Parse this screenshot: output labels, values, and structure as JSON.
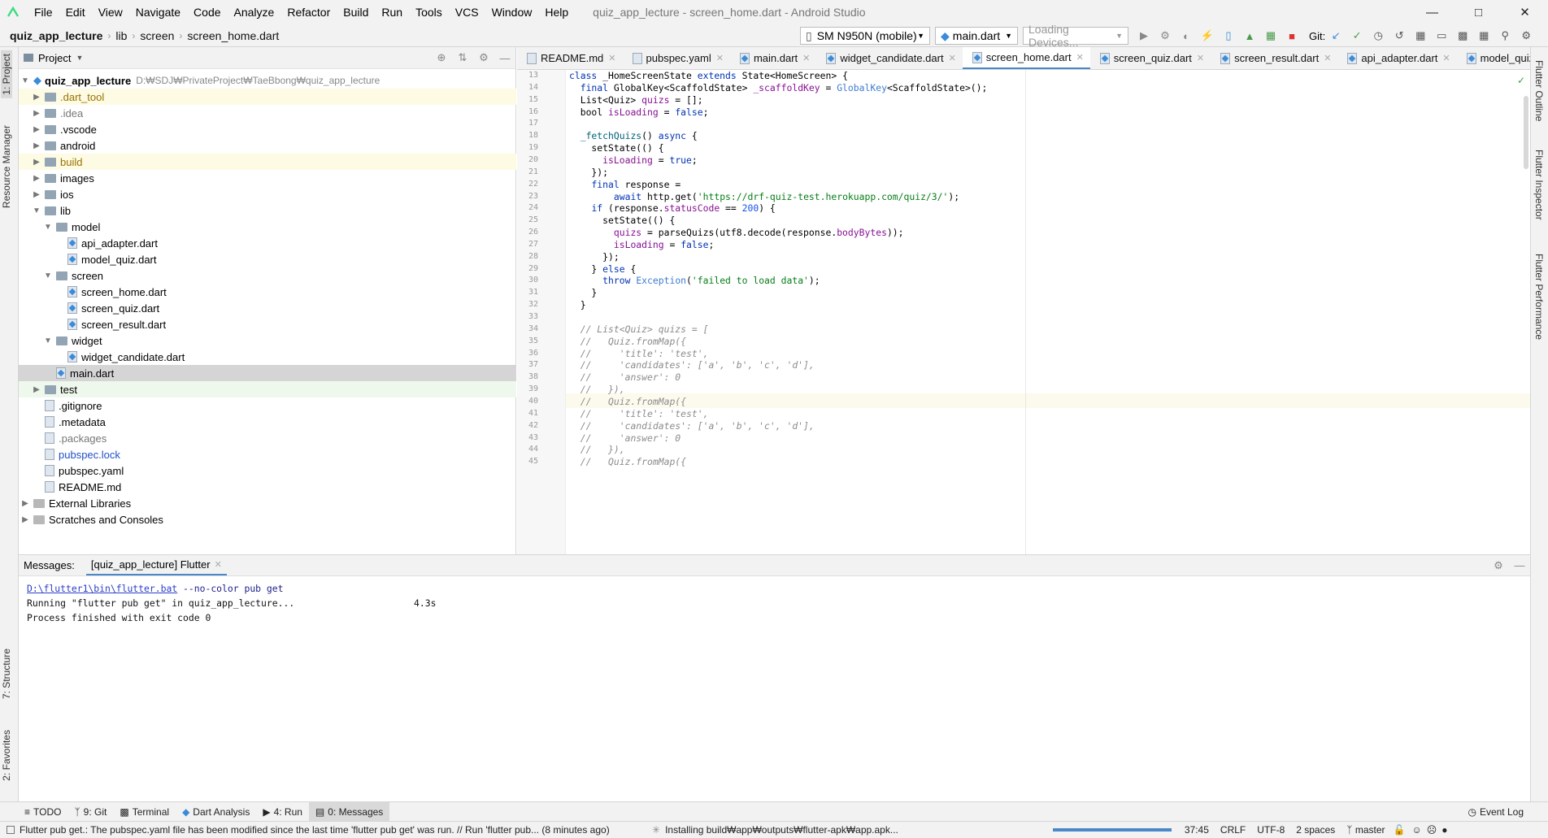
{
  "titlebar": {
    "menu": [
      "File",
      "Edit",
      "View",
      "Navigate",
      "Code",
      "Analyze",
      "Refactor",
      "Build",
      "Run",
      "Tools",
      "VCS",
      "Window",
      "Help"
    ],
    "window_title": "quiz_app_lecture - screen_home.dart - Android Studio"
  },
  "navbar": {
    "breadcrumbs": [
      "quiz_app_lecture",
      "lib",
      "screen",
      "screen_home.dart"
    ],
    "device": "SM N950N (mobile)",
    "run_config": "main.dart",
    "loading_devices": "Loading Devices...",
    "git_label": "Git:"
  },
  "sidebar_left": {
    "tabs": [
      "1: Project",
      "Resource Manager",
      "7: Structure",
      "2: Favorites"
    ]
  },
  "sidebar_right": {
    "tabs": [
      "Flutter Outline",
      "Flutter Inspector",
      "Flutter Performance"
    ]
  },
  "project": {
    "header": "Project",
    "root_name": "quiz_app_lecture",
    "root_path": "D:₩SDJ₩PrivateProject₩TaeBbong₩quiz_app_lecture",
    "items": [
      {
        "label": ".dart_tool",
        "kind": "folder",
        "depth": 1,
        "arrow": "▶",
        "color": "#9a7200",
        "hl": true
      },
      {
        "label": ".idea",
        "kind": "folder",
        "depth": 1,
        "arrow": "▶",
        "color": "#777777",
        "hl": false
      },
      {
        "label": ".vscode",
        "kind": "folder",
        "depth": 1,
        "arrow": "▶",
        "color": "#000000",
        "hl": false
      },
      {
        "label": "android",
        "kind": "folder",
        "depth": 1,
        "arrow": "▶",
        "color": "#000000",
        "hl": false
      },
      {
        "label": "build",
        "kind": "folder",
        "depth": 1,
        "arrow": "▶",
        "color": "#9a7200",
        "hl": true
      },
      {
        "label": "images",
        "kind": "folder",
        "depth": 1,
        "arrow": "▶",
        "color": "#000000",
        "hl": false
      },
      {
        "label": "ios",
        "kind": "folder",
        "depth": 1,
        "arrow": "▶",
        "color": "#000000",
        "hl": false
      },
      {
        "label": "lib",
        "kind": "folder",
        "depth": 1,
        "arrow": "▼",
        "color": "#000000",
        "hl": false
      },
      {
        "label": "model",
        "kind": "folder",
        "depth": 2,
        "arrow": "▼",
        "color": "#000000",
        "hl": false
      },
      {
        "label": "api_adapter.dart",
        "kind": "dart",
        "depth": 3,
        "arrow": "",
        "color": "#000000",
        "hl": false
      },
      {
        "label": "model_quiz.dart",
        "kind": "dart",
        "depth": 3,
        "arrow": "",
        "color": "#000000",
        "hl": false
      },
      {
        "label": "screen",
        "kind": "folder",
        "depth": 2,
        "arrow": "▼",
        "color": "#000000",
        "hl": false
      },
      {
        "label": "screen_home.dart",
        "kind": "dart",
        "depth": 3,
        "arrow": "",
        "color": "#000000",
        "hl": false
      },
      {
        "label": "screen_quiz.dart",
        "kind": "dart",
        "depth": 3,
        "arrow": "",
        "color": "#000000",
        "hl": false
      },
      {
        "label": "screen_result.dart",
        "kind": "dart",
        "depth": 3,
        "arrow": "",
        "color": "#000000",
        "hl": false
      },
      {
        "label": "widget",
        "kind": "folder",
        "depth": 2,
        "arrow": "▼",
        "color": "#000000",
        "hl": false
      },
      {
        "label": "widget_candidate.dart",
        "kind": "dart",
        "depth": 3,
        "arrow": "",
        "color": "#000000",
        "hl": false
      },
      {
        "label": "main.dart",
        "kind": "dart",
        "depth": 2,
        "arrow": "",
        "color": "#000000",
        "hl": false,
        "selected": true
      },
      {
        "label": "test",
        "kind": "folder",
        "depth": 1,
        "arrow": "▶",
        "color": "#000000",
        "hl": false,
        "green": true
      },
      {
        "label": ".gitignore",
        "kind": "file",
        "depth": 1,
        "arrow": "",
        "color": "#000000",
        "hl": false
      },
      {
        "label": ".metadata",
        "kind": "file",
        "depth": 1,
        "arrow": "",
        "color": "#000000",
        "hl": false
      },
      {
        "label": ".packages",
        "kind": "file",
        "depth": 1,
        "arrow": "",
        "color": "#777777",
        "hl": false
      },
      {
        "label": "pubspec.lock",
        "kind": "file",
        "depth": 1,
        "arrow": "",
        "color": "#1f4fc7",
        "hl": false
      },
      {
        "label": "pubspec.yaml",
        "kind": "file",
        "depth": 1,
        "arrow": "",
        "color": "#000000",
        "hl": false
      },
      {
        "label": "README.md",
        "kind": "file",
        "depth": 1,
        "arrow": "",
        "color": "#000000",
        "hl": false
      },
      {
        "label": "External Libraries",
        "kind": "lib",
        "depth": 0,
        "arrow": "▶",
        "color": "#000000",
        "hl": false
      },
      {
        "label": "Scratches and Consoles",
        "kind": "lib",
        "depth": 0,
        "arrow": "▶",
        "color": "#000000",
        "hl": false
      }
    ]
  },
  "editor": {
    "tabs": [
      "README.md",
      "pubspec.yaml",
      "main.dart",
      "widget_candidate.dart",
      "screen_home.dart",
      "screen_quiz.dart",
      "screen_result.dart",
      "api_adapter.dart",
      "model_quiz.dart"
    ],
    "active_tab": 4,
    "line_numbers": [
      "13",
      "14",
      "15",
      "16",
      "17",
      "18",
      "19",
      "20",
      "21",
      "22",
      "23",
      "24",
      "25",
      "26",
      "27",
      "28",
      "29",
      "30",
      "31",
      "32",
      "33",
      "34",
      "35",
      "36",
      "37",
      "38",
      "39",
      "40",
      "41",
      "42",
      "43",
      "44",
      "45"
    ],
    "lines": [
      [
        [
          "kw",
          "class "
        ],
        [
          "",
          "_HomeScreenState "
        ],
        [
          "kw",
          "extends "
        ],
        [
          "",
          "State<HomeScreen> {"
        ]
      ],
      [
        [
          "",
          "  "
        ],
        [
          "kw",
          "final "
        ],
        [
          "",
          "GlobalKey<ScaffoldState> "
        ],
        [
          "fld",
          "_scaffoldKey"
        ],
        [
          "",
          " = "
        ],
        [
          "typ",
          "GlobalKey"
        ],
        [
          "",
          "<ScaffoldState>();"
        ]
      ],
      [
        [
          "",
          "  List<Quiz> "
        ],
        [
          "fld",
          "quizs"
        ],
        [
          "",
          " = [];"
        ]
      ],
      [
        [
          "",
          "  bool "
        ],
        [
          "fld",
          "isLoading"
        ],
        [
          "",
          " = "
        ],
        [
          "kw",
          "false"
        ],
        [
          "",
          ";"
        ]
      ],
      [
        [
          "",
          ""
        ]
      ],
      [
        [
          "",
          "  "
        ],
        [
          "fn",
          "_fetchQuizs"
        ],
        [
          "",
          "() "
        ],
        [
          "kw",
          "async"
        ],
        [
          "",
          " {"
        ]
      ],
      [
        [
          "",
          "    setState(() {"
        ]
      ],
      [
        [
          "",
          "      "
        ],
        [
          "fld",
          "isLoading"
        ],
        [
          "",
          " = "
        ],
        [
          "kw",
          "true"
        ],
        [
          "",
          ";"
        ]
      ],
      [
        [
          "",
          "    });"
        ]
      ],
      [
        [
          "",
          "    "
        ],
        [
          "kw",
          "final "
        ],
        [
          "",
          "response ="
        ]
      ],
      [
        [
          "",
          "        "
        ],
        [
          "kw",
          "await "
        ],
        [
          "",
          "http.get("
        ],
        [
          "str",
          "'https://drf-quiz-test.herokuapp.com/quiz/3/'"
        ],
        [
          "",
          ");"
        ]
      ],
      [
        [
          "",
          "    "
        ],
        [
          "kw",
          "if "
        ],
        [
          "",
          "(response."
        ],
        [
          "fld",
          "statusCode"
        ],
        [
          "",
          " == "
        ],
        [
          "num",
          "200"
        ],
        [
          "",
          ") {"
        ]
      ],
      [
        [
          "",
          "      setState(() {"
        ]
      ],
      [
        [
          "",
          "        "
        ],
        [
          "fld",
          "quizs"
        ],
        [
          "",
          " = parseQuizs(utf8.decode(response."
        ],
        [
          "fld",
          "bodyBytes"
        ],
        [
          "",
          "));"
        ]
      ],
      [
        [
          "",
          "        "
        ],
        [
          "fld",
          "isLoading"
        ],
        [
          "",
          " = "
        ],
        [
          "kw",
          "false"
        ],
        [
          "",
          ";"
        ]
      ],
      [
        [
          "",
          "      });"
        ]
      ],
      [
        [
          "",
          "    } "
        ],
        [
          "kw",
          "else "
        ],
        [
          "",
          "{"
        ]
      ],
      [
        [
          "",
          "      "
        ],
        [
          "kw",
          "throw "
        ],
        [
          "typ",
          "Exception"
        ],
        [
          "",
          "("
        ],
        [
          "str",
          "'failed to load data'"
        ],
        [
          "",
          ");"
        ]
      ],
      [
        [
          "",
          "    }"
        ]
      ],
      [
        [
          "",
          "  }"
        ]
      ],
      [
        [
          "",
          ""
        ]
      ],
      [
        [
          "",
          "  "
        ],
        [
          "cmt",
          "// List<Quiz> quizs = ["
        ]
      ],
      [
        [
          "",
          "  "
        ],
        [
          "cmt",
          "//   Quiz.fromMap({"
        ]
      ],
      [
        [
          "",
          "  "
        ],
        [
          "cmt",
          "//     'title': 'test',"
        ]
      ],
      [
        [
          "",
          "  "
        ],
        [
          "cmt",
          "//     'candidates': ['a', 'b', 'c', 'd'],"
        ]
      ],
      [
        [
          "",
          "  "
        ],
        [
          "cmt",
          "//     'answer': 0"
        ]
      ],
      [
        [
          "",
          "  "
        ],
        [
          "cmt",
          "//   }),"
        ]
      ],
      [
        [
          "",
          "  "
        ],
        [
          "cmt",
          "//   Quiz.fromMap({"
        ]
      ],
      [
        [
          "",
          "  "
        ],
        [
          "cmt",
          "//     'title': 'test',"
        ]
      ],
      [
        [
          "",
          "  "
        ],
        [
          "cmt",
          "//     'candidates': ['a', 'b', 'c', 'd'],"
        ]
      ],
      [
        [
          "",
          "  "
        ],
        [
          "cmt",
          "//     'answer': 0"
        ]
      ],
      [
        [
          "",
          "  "
        ],
        [
          "cmt",
          "//   }),"
        ]
      ],
      [
        [
          "",
          "  "
        ],
        [
          "cmt",
          "//   Quiz.fromMap({"
        ]
      ]
    ]
  },
  "messages": {
    "label": "Messages:",
    "tab": "[quiz_app_lecture] Flutter",
    "cmd_link": "D:\\flutter1\\bin\\flutter.bat",
    "cmd_args": " --no-color pub get",
    "running": "Running \"flutter pub get\" in quiz_app_lecture...",
    "duration": "4.3s",
    "finished": "Process finished with exit code 0"
  },
  "tooltabs": [
    "TODO",
    "9: Git",
    "Terminal",
    "Dart Analysis",
    "4: Run",
    "0: Messages"
  ],
  "event_log": "Event Log",
  "status": {
    "message": "Flutter pub get.: The pubspec.yaml file has been modified since the last time 'flutter pub get' was run. // Run 'flutter pub... (8 minutes ago)",
    "installing": "Installing build₩app₩outputs₩flutter-apk₩app.apk...",
    "position": "37:45",
    "line_sep": "CRLF",
    "encoding": "UTF-8",
    "indent": "2 spaces",
    "branch": "master"
  }
}
